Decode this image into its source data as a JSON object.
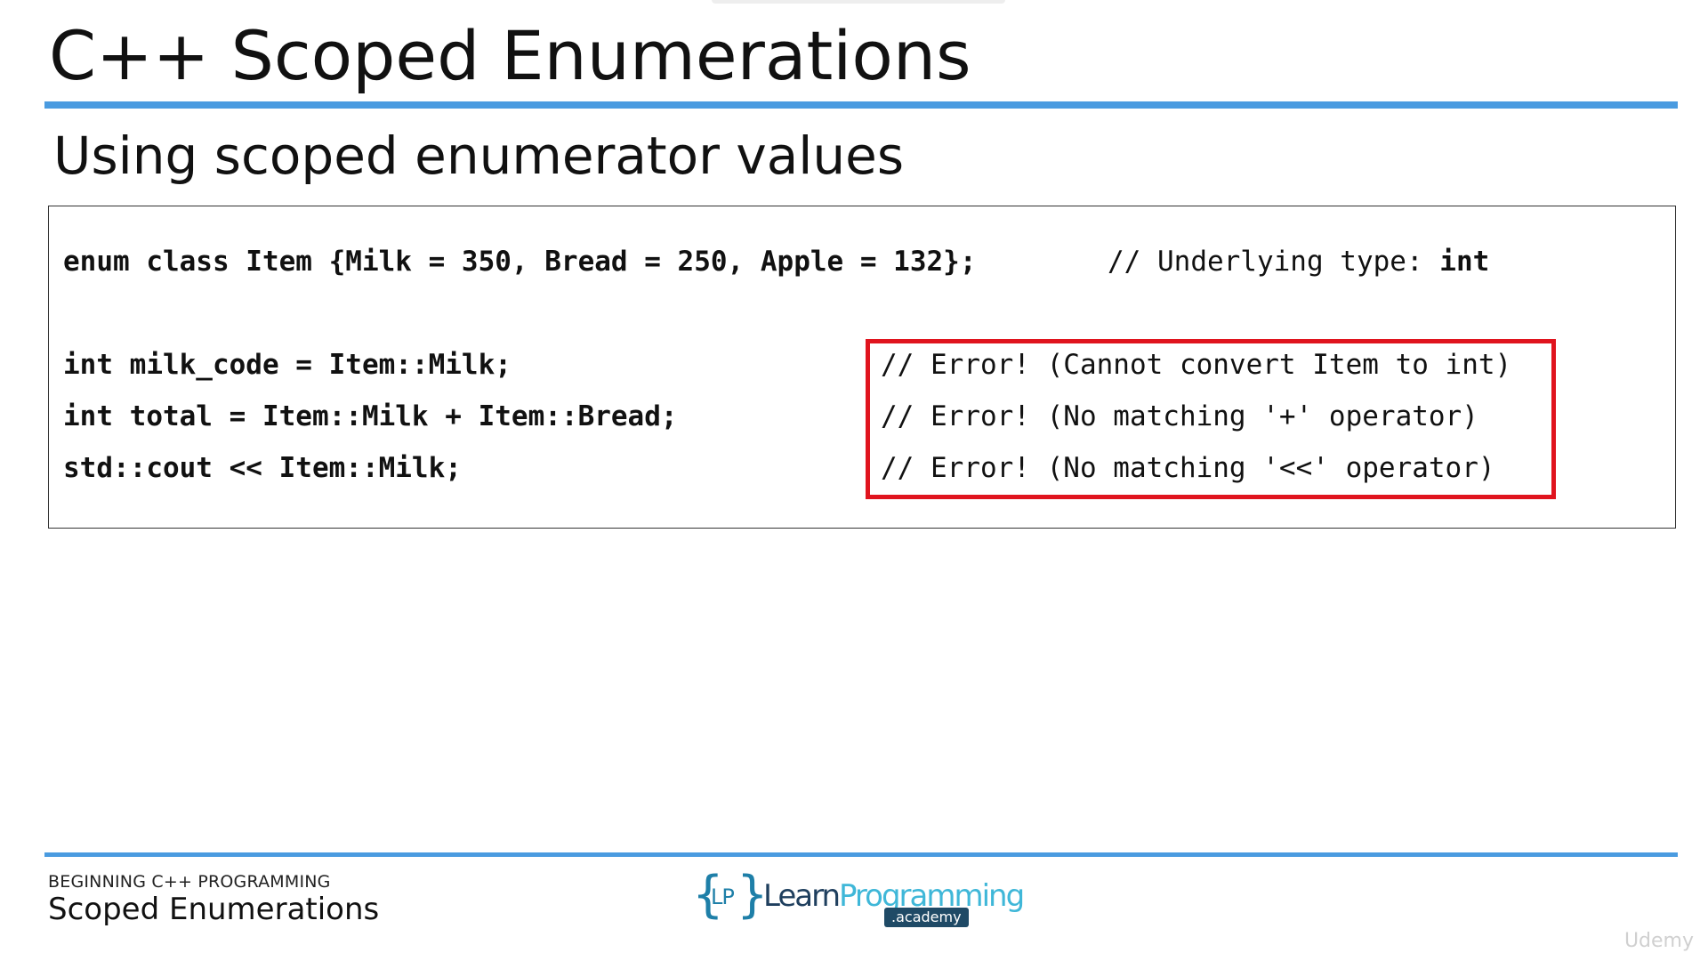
{
  "slide": {
    "title": "C++ Scoped Enumerations",
    "subtitle": "Using scoped enumerator values"
  },
  "code": {
    "enum_line": "enum class Item {Milk = 350, Bread = 250, Apple = 132};",
    "enum_comment_prefix": "// Underlying type: ",
    "enum_comment_type": "int",
    "milk_code_line": "int milk_code = Item::Milk;",
    "total_line": "int total = Item::Milk + Item::Bread;",
    "cout_line": "std::cout << Item::Milk;"
  },
  "errors": {
    "line1": "// Error! (Cannot convert Item to int)",
    "line2": "// Error! (No matching '+' operator)",
    "line3": "// Error! (No matching '<<' operator)",
    "highlight_color": "#e0141e"
  },
  "footer": {
    "course": "BEGINNING C++ PROGRAMMING",
    "topic": "Scoped Enumerations"
  },
  "logo": {
    "brace_left": "{",
    "brace_right": "}",
    "monogram": "LP",
    "learn": "Learn",
    "programming": "Programming",
    "academy": ".academy"
  },
  "watermark": "Udemy",
  "colors": {
    "accent_rule": "#4a9be0",
    "error_box": "#e0141e"
  }
}
